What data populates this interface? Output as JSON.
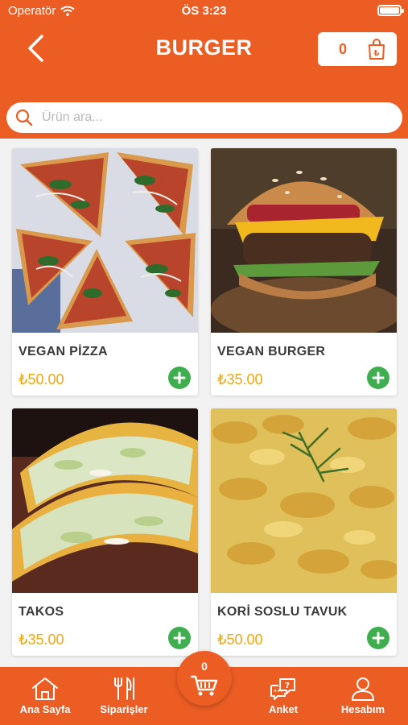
{
  "status_bar": {
    "carrier": "Operatör",
    "time": "ÖS 3:23"
  },
  "header": {
    "title": "BURGER",
    "cart_count": "0"
  },
  "search": {
    "placeholder": "Ürün ara..."
  },
  "products": [
    {
      "name": "VEGAN PİZZA",
      "price": "₺50.00",
      "image": "pizza-photo"
    },
    {
      "name": "VEGAN BURGER",
      "price": "₺35.00",
      "image": "burger-photo"
    },
    {
      "name": "TAKOS",
      "price": "₺35.00",
      "image": "taco-photo"
    },
    {
      "name": "KORİ SOSLU TAVUK",
      "price": "₺50.00",
      "image": "curry-chicken-photo"
    }
  ],
  "tabbar": {
    "home": "Ana Sayfa",
    "orders": "Siparişler",
    "cart_count": "0",
    "survey": "Anket",
    "account": "Hesabım"
  },
  "colors": {
    "brand": "#ec5d24",
    "price": "#f4a60b",
    "add": "#3fae4e"
  }
}
